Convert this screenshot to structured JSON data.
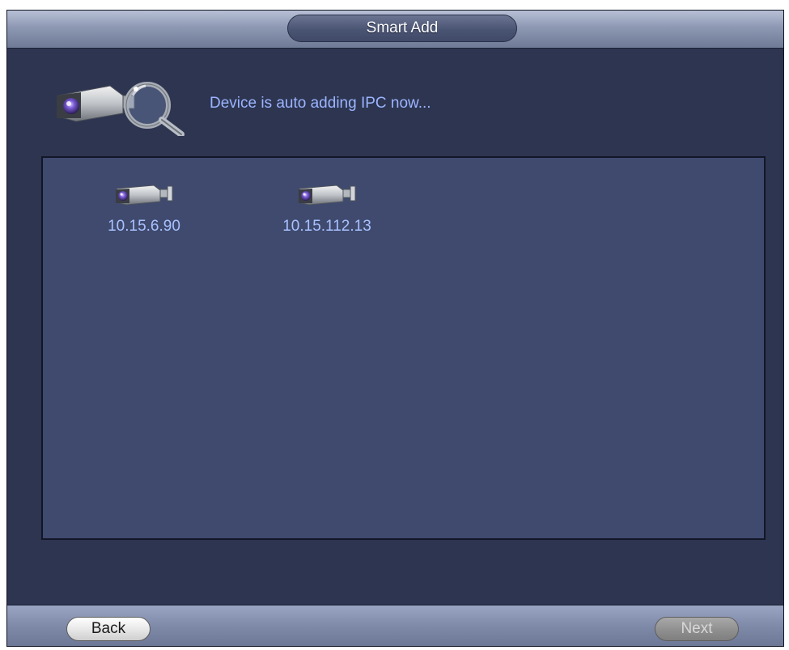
{
  "window": {
    "title": "Smart Add"
  },
  "status": {
    "message": "Device is auto adding IPC now..."
  },
  "devices": [
    {
      "ip": "10.15.6.90",
      "icon": "camera-icon"
    },
    {
      "ip": "10.15.112.13",
      "icon": "camera-icon"
    }
  ],
  "footer": {
    "back_label": "Back",
    "next_label": "Next",
    "next_enabled": false
  },
  "colors": {
    "background": "#2d3551",
    "panel": "#3f4a6e",
    "accent_text": "#9cb4ff"
  }
}
